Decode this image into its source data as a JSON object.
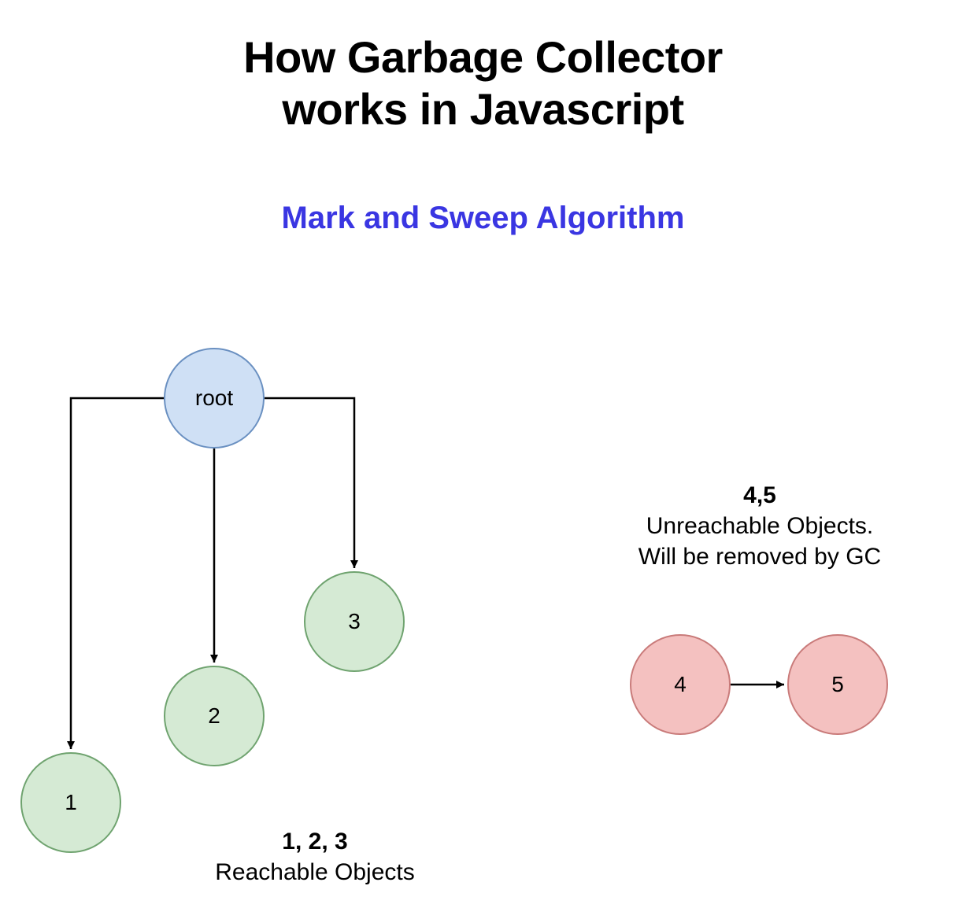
{
  "title_line1": "How Garbage Collector",
  "title_line2": "works in Javascript",
  "subtitle": "Mark and Sweep Algorithm",
  "nodes": {
    "root": "root",
    "n1": "1",
    "n2": "2",
    "n3": "3",
    "n4": "4",
    "n5": "5"
  },
  "reachable_caption": {
    "heading": "1, 2, 3",
    "body": "Reachable Objects"
  },
  "unreachable_caption": {
    "heading": "4,5",
    "body_line1": "Unreachable Objects.",
    "body_line2": "Will be removed by GC"
  }
}
